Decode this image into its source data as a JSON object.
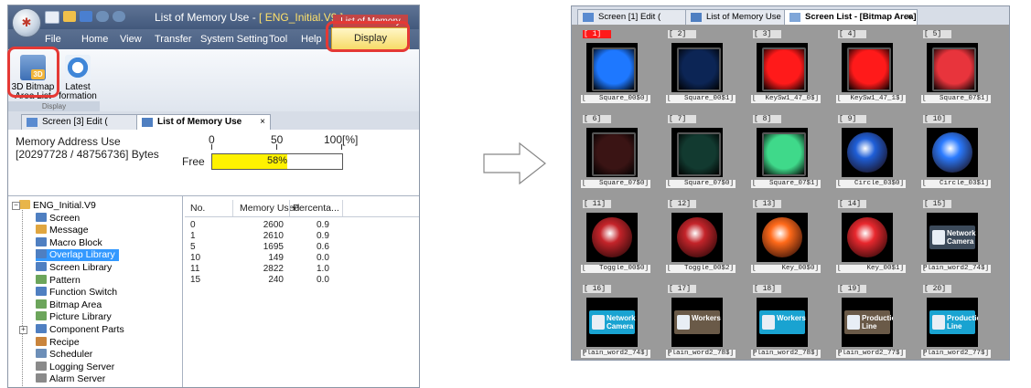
{
  "app": {
    "title_prefix": "List of Memory Use - ",
    "title_file": "[ ENG_Initial.V9 ]",
    "context_tab_title": "List of Memory Use",
    "menu": [
      "File",
      "Home",
      "View",
      "Transfer",
      "System Setting",
      "Tool",
      "Help"
    ],
    "display_tab": "Display",
    "ribbon": {
      "btn1_line1": "3D Bitmap",
      "btn1_line2": "Area List",
      "btn2_line1": "Latest",
      "btn2_line2": "formation",
      "group": "Display"
    },
    "doc_tabs": {
      "inactive": "Screen [3] Edit (",
      "active": "List of Memory Use",
      "close": "×"
    },
    "memory": {
      "label": "Memory Address Use",
      "bytes": "[20297728 / 48756736] Bytes",
      "scale": [
        "0",
        "50",
        "100[%]"
      ],
      "free_label": "Free",
      "percent_text": "58%",
      "percent_value": 58
    },
    "tree": [
      {
        "label": "ENG_Initial.V9",
        "icon": "folder-icon",
        "color": "#e8b54a",
        "level": 0
      },
      {
        "label": "Screen",
        "icon": "screen-icon",
        "color": "#4f7fc1",
        "level": 1
      },
      {
        "label": "Message",
        "icon": "message-icon",
        "color": "#e0a640",
        "level": 1
      },
      {
        "label": "Macro Block",
        "icon": "macro-icon",
        "color": "#4f7fc1",
        "level": 1
      },
      {
        "label": "Overlap Library",
        "icon": "overlap-icon",
        "color": "#4f7fc1",
        "level": 1,
        "selected": true
      },
      {
        "label": "Screen Library",
        "icon": "library-icon",
        "color": "#4f7fc1",
        "level": 1
      },
      {
        "label": "Pattern",
        "icon": "pattern-icon",
        "color": "#6ca55b",
        "level": 1
      },
      {
        "label": "Function Switch",
        "icon": "function-switch-icon",
        "color": "#4f7fc1",
        "level": 1
      },
      {
        "label": "Bitmap Area",
        "icon": "bitmap-icon",
        "color": "#6ca55b",
        "level": 1
      },
      {
        "label": "Picture Library",
        "icon": "picture-icon",
        "color": "#6ca55b",
        "level": 1
      },
      {
        "label": "Component Parts",
        "icon": "component-icon",
        "color": "#4f7fc1",
        "level": 1
      },
      {
        "label": "Recipe",
        "icon": "recipe-icon",
        "color": "#c9843c",
        "level": 1
      },
      {
        "label": "Scheduler",
        "icon": "scheduler-icon",
        "color": "#6d8fb8",
        "level": 1
      },
      {
        "label": "Logging Server",
        "icon": "server-icon",
        "color": "#8a8a8a",
        "level": 1
      },
      {
        "label": "Alarm Server",
        "icon": "server-icon",
        "color": "#8a8a8a",
        "level": 1
      }
    ],
    "table": {
      "headers": [
        "No.",
        "Memory Used",
        "Percenta..."
      ],
      "rows": [
        [
          "0",
          "2600",
          "0.9"
        ],
        [
          "1",
          "2610",
          "0.9"
        ],
        [
          "5",
          "1695",
          "0.6"
        ],
        [
          "10",
          "149",
          "0.0"
        ],
        [
          "11",
          "2822",
          "1.0"
        ],
        [
          "15",
          "240",
          "0.0"
        ]
      ]
    }
  },
  "screen_list": {
    "tabs": [
      {
        "label": "Screen [1] Edit (",
        "close": ")"
      },
      {
        "label": "List of Memory Use"
      },
      {
        "label": "Screen List - [Bitmap Area]",
        "close": "×"
      }
    ],
    "items": [
      {
        "idx": "[ 1]",
        "name": "Square_00$0]",
        "kind": "square",
        "color": "#1e78ff",
        "selected": true
      },
      {
        "idx": "[ 2]",
        "name": "Square_00$1]",
        "kind": "square",
        "color": "#0c2555"
      },
      {
        "idx": "[ 3]",
        "name": "KeySw1_47_0$]",
        "kind": "square",
        "color": "#ff1a1a"
      },
      {
        "idx": "[ 4]",
        "name": "KeySw1_47_1$]",
        "kind": "square",
        "color": "#ff1a1a"
      },
      {
        "idx": "[ 5]",
        "name": "Square_07$1]",
        "kind": "square",
        "color": "#e8343c"
      },
      {
        "idx": "[ 6]",
        "name": "Square_07$0]",
        "kind": "square",
        "color": "#3a1414"
      },
      {
        "idx": "[ 7]",
        "name": "Square_07$0]",
        "kind": "square",
        "color": "#123a30"
      },
      {
        "idx": "[ 8]",
        "name": "Square_07$1]",
        "kind": "square",
        "color": "#3fd98a"
      },
      {
        "idx": "[ 9]",
        "name": "Circle_03$0]",
        "kind": "circle",
        "color": "#1f5fd8"
      },
      {
        "idx": "[ 10]",
        "name": "Circle_03$1]",
        "kind": "circle",
        "color": "#2b7bff"
      },
      {
        "idx": "[ 11]",
        "name": "Toggle_00$0]",
        "kind": "circle",
        "color": "#c4242a"
      },
      {
        "idx": "[ 12]",
        "name": "Toggle_00$2]",
        "kind": "circle",
        "color": "#c4242a"
      },
      {
        "idx": "[ 13]",
        "name": "Key_00$0]",
        "kind": "circle",
        "color": "#ff6a1a"
      },
      {
        "idx": "[ 14]",
        "name": "Key_00$1]",
        "kind": "circle",
        "color": "#e8282e"
      },
      {
        "idx": "[ 15]",
        "name": "Plain_word2_74$]",
        "kind": "word",
        "color": "#3c4a5a",
        "word": "Network Camera"
      },
      {
        "idx": "[ 16]",
        "name": "Plain_word2_74$]",
        "kind": "word",
        "color": "#19a3d1",
        "word": "Network Camera"
      },
      {
        "idx": "[ 17]",
        "name": "Plain_word2_78$]",
        "kind": "word",
        "color": "#6a5a48",
        "word": "Workers"
      },
      {
        "idx": "[ 18]",
        "name": "Plain_word2_78$]",
        "kind": "word",
        "color": "#19a3d1",
        "word": "Workers"
      },
      {
        "idx": "[ 19]",
        "name": "Plain_word2_77$]",
        "kind": "word",
        "color": "#6a5a48",
        "word": "Production Line"
      },
      {
        "idx": "[ 20]",
        "name": "Plain_word2_77$]",
        "kind": "word",
        "color": "#19a3d1",
        "word": "Production Line"
      }
    ]
  },
  "colors": {
    "highlight_red": "#e53935",
    "progress_fill": "#fff200",
    "selection_blue": "#3399ff"
  }
}
